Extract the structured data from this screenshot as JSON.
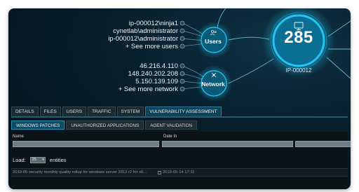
{
  "graph": {
    "user_items": [
      "ip-000012\\ninja1",
      "cynetlab\\administrator",
      "ip-000012\\administrator",
      "+ See more users"
    ],
    "network_items": [
      "46.216.4.110",
      "148.240.202.208",
      "5.150.139.109",
      "+ See more network"
    ],
    "users_node_label": "Users",
    "network_node_label": "Network",
    "center_value": "285",
    "center_host": "IP-000012",
    "icons": {
      "users": "users-icon",
      "network": "network-icon",
      "center": "monitor-icon",
      "item": "info-dot-icon"
    },
    "colors": {
      "accent": "#16b4e8",
      "node_fill": "#0a5f80",
      "line": "#5fa9c4"
    }
  },
  "tabs": [
    "DETAILS",
    "FILES",
    "USERS",
    "TRAFFIC",
    "SYSTEM",
    "VULNERABILITY ASSESSMENT"
  ],
  "active_tab": "VULNERABILITY ASSESSMENT",
  "subtabs": [
    "WINDOWS PATCHES",
    "UNAUTHORIZED APPLICATIONS",
    "AGENT VALIDATION"
  ],
  "active_subtab": "WINDOWS PATCHES",
  "table": {
    "columns": [
      "Name",
      "Date In"
    ],
    "load_label": "Load:",
    "load_value": "25",
    "entities_label": "entities",
    "rows": [
      {
        "name": "2019-05 security monthly quality rollup for windows server 2012 r2 for x6...",
        "date": "2019-05-14 17:11"
      }
    ]
  }
}
